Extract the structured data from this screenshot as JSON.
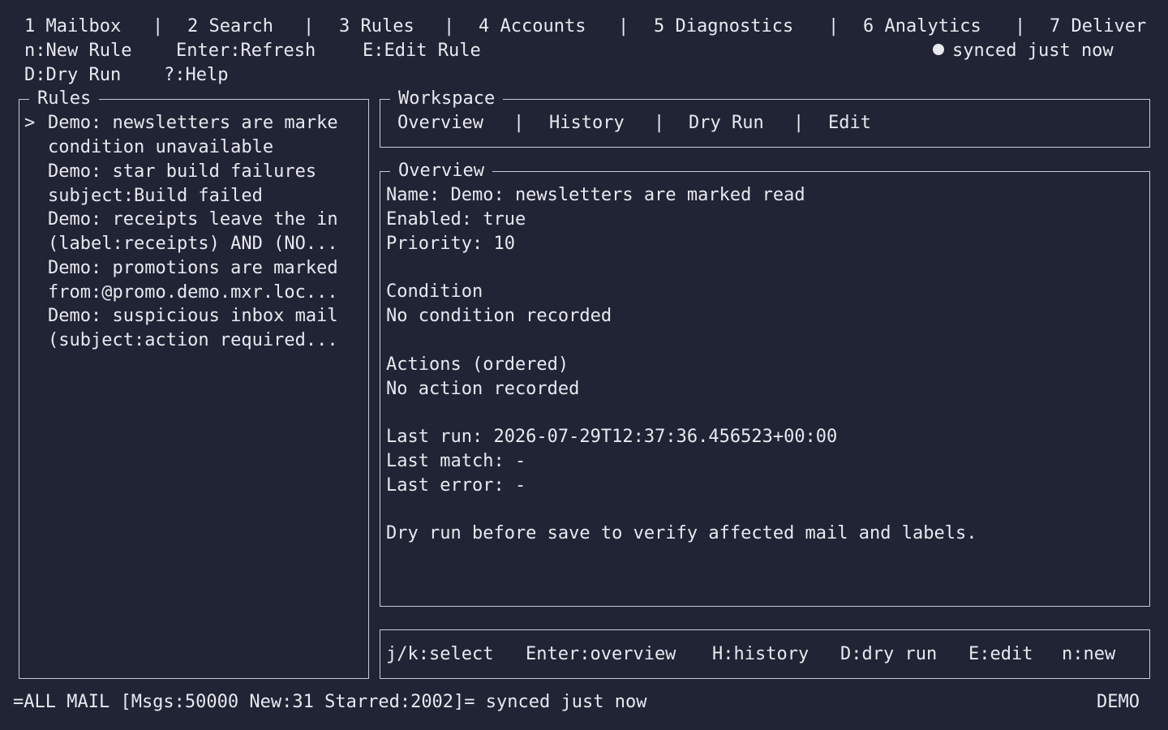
{
  "top_tabs": [
    {
      "label": "1 Mailbox"
    },
    {
      "label": "2 Search"
    },
    {
      "label": "3 Rules"
    },
    {
      "label": "4 Accounts"
    },
    {
      "label": "5 Diagnostics"
    },
    {
      "label": "6 Analytics"
    },
    {
      "label": "7 Deliver"
    }
  ],
  "separator": "|",
  "shortcuts": {
    "new_rule": "n:New Rule",
    "refresh": "Enter:Refresh",
    "edit_rule": "E:Edit Rule",
    "dry_run": "D:Dry Run",
    "help": "?:Help"
  },
  "sync_status": "synced just now",
  "rules_panel": {
    "title": "Rules",
    "cursor": ">",
    "items": [
      {
        "name": "Demo: newsletters are marke",
        "detail": "condition unavailable"
      },
      {
        "name": "Demo: star build failures",
        "detail": "subject:Build failed"
      },
      {
        "name": "Demo: receipts leave the in",
        "detail": "(label:receipts) AND (NO..."
      },
      {
        "name": "Demo: promotions are marked",
        "detail": "from:@promo.demo.mxr.loc..."
      },
      {
        "name": "Demo: suspicious inbox mail",
        "detail": "(subject:action required..."
      }
    ]
  },
  "workspace": {
    "title": "Workspace",
    "tabs": [
      {
        "label": "Overview"
      },
      {
        "label": "History"
      },
      {
        "label": "Dry Run"
      },
      {
        "label": "Edit"
      }
    ]
  },
  "overview": {
    "title": "Overview",
    "name_line": "Name: Demo: newsletters are marked read",
    "enabled_line": "Enabled: true",
    "priority_line": "Priority: 10",
    "condition_heading": "Condition",
    "condition_value": "No condition recorded",
    "actions_heading": "Actions (ordered)",
    "actions_value": "No action recorded",
    "last_run_line": "Last run: 2026-07-29T12:37:36.456523+00:00",
    "last_match_line": "Last match: -",
    "last_error_line": "Last error: -",
    "hint": "Dry run before save to verify affected mail and labels."
  },
  "keybar": [
    {
      "label": "j/k:select"
    },
    {
      "label": "Enter:overview"
    },
    {
      "label": "H:history"
    },
    {
      "label": "D:dry run"
    },
    {
      "label": "E:edit"
    },
    {
      "label": "n:new"
    }
  ],
  "statusbar": {
    "left": "=ALL MAIL [Msgs:50000 New:31 Starred:2002]= synced just now",
    "right": "DEMO"
  },
  "colors": {
    "background": "#202435",
    "foreground": "#e8e9ef",
    "border": "#c9ccd6"
  }
}
